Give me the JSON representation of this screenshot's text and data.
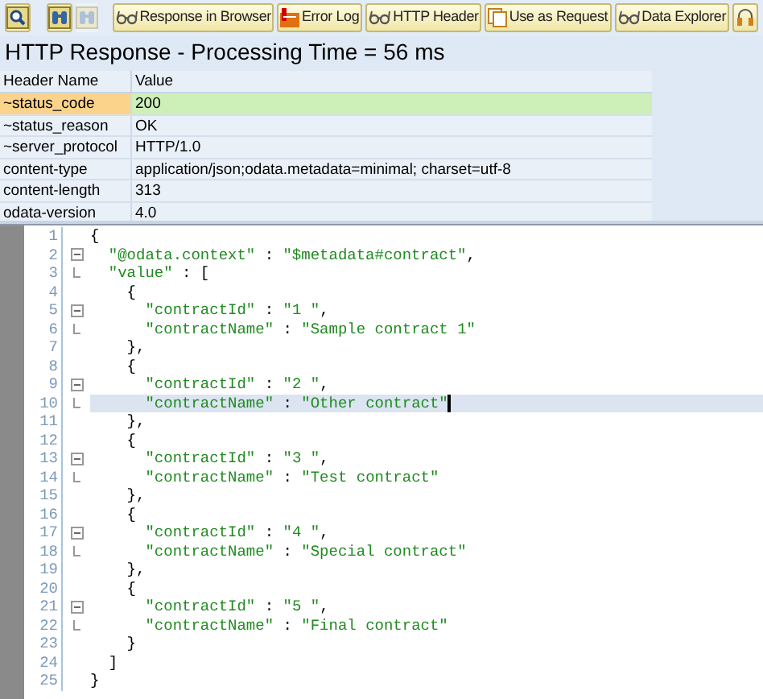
{
  "toolbar": {
    "icon_buttons": [
      {
        "kind": "search",
        "disabled": false
      },
      {
        "kind": "find",
        "disabled": false
      },
      {
        "kind": "find",
        "disabled": true
      }
    ],
    "buttons": [
      {
        "kind": "glasses",
        "label": "Response in Browser"
      },
      {
        "kind": "log",
        "label": "Error Log"
      },
      {
        "kind": "glasses",
        "label": "HTTP Header"
      },
      {
        "kind": "copy",
        "label": "Use as Request"
      },
      {
        "kind": "glasses",
        "label": "Data Explorer"
      },
      {
        "kind": "more"
      }
    ]
  },
  "title": "HTTP Response - Processing Time = 56  ms",
  "header_table": {
    "columns": [
      "Header Name",
      "Value"
    ],
    "rows": [
      {
        "name": "~status_code",
        "value": "200",
        "selected": true
      },
      {
        "name": "~status_reason",
        "value": "OK",
        "selected": false
      },
      {
        "name": "~server_protocol",
        "value": "HTTP/1.0",
        "selected": false
      },
      {
        "name": "content-type",
        "value": "application/json;odata.metadata=minimal; charset=utf-8",
        "selected": false
      },
      {
        "name": "content-length",
        "value": "313",
        "selected": false
      },
      {
        "name": "odata-version",
        "value": "4.0",
        "selected": false
      }
    ]
  },
  "editor": {
    "lines": [
      {
        "number": "1",
        "text": "{",
        "selected": false
      },
      {
        "number": "2",
        "text": "  \"@odata.context\" : \"$metadata#contract\",",
        "kind": "open",
        "selected": false
      },
      {
        "number": "3",
        "text": "  \"value\" : [",
        "kind": "end",
        "selected": false
      },
      {
        "number": "4",
        "text": "    {",
        "selected": false
      },
      {
        "number": "5",
        "text": "      \"contractId\" : \"1 \",",
        "kind": "open",
        "selected": false
      },
      {
        "number": "6",
        "text": "      \"contractName\" : \"Sample contract 1\"",
        "kind": "end",
        "selected": false
      },
      {
        "number": "7",
        "text": "    },",
        "selected": false
      },
      {
        "number": "8",
        "text": "    {",
        "selected": false
      },
      {
        "number": "9",
        "text": "      \"contractId\" : \"2 \",",
        "kind": "open",
        "selected": false
      },
      {
        "number": "10",
        "text": "      \"contractName\" : \"Other contract\"",
        "kind": "end",
        "selected": true
      },
      {
        "number": "11",
        "text": "    },",
        "selected": false
      },
      {
        "number": "12",
        "text": "    {",
        "selected": false
      },
      {
        "number": "13",
        "text": "      \"contractId\" : \"3 \",",
        "kind": "open",
        "selected": false
      },
      {
        "number": "14",
        "text": "      \"contractName\" : \"Test contract\"",
        "kind": "end",
        "selected": false
      },
      {
        "number": "15",
        "text": "    },",
        "selected": false
      },
      {
        "number": "16",
        "text": "    {",
        "selected": false
      },
      {
        "number": "17",
        "text": "      \"contractId\" : \"4 \",",
        "kind": "open",
        "selected": false
      },
      {
        "number": "18",
        "text": "      \"contractName\" : \"Special contract\"",
        "kind": "end",
        "selected": false
      },
      {
        "number": "19",
        "text": "    },",
        "selected": false
      },
      {
        "number": "20",
        "text": "    {",
        "selected": false
      },
      {
        "number": "21",
        "text": "      \"contractId\" : \"5 \",",
        "kind": "open",
        "selected": false
      },
      {
        "number": "22",
        "text": "      \"contractName\" : \"Final contract\"",
        "kind": "end",
        "selected": false
      },
      {
        "number": "23",
        "text": "    }",
        "selected": false
      },
      {
        "number": "24",
        "text": "  ]",
        "selected": false
      },
      {
        "number": "25",
        "text": "}",
        "selected": false
      }
    ]
  }
}
